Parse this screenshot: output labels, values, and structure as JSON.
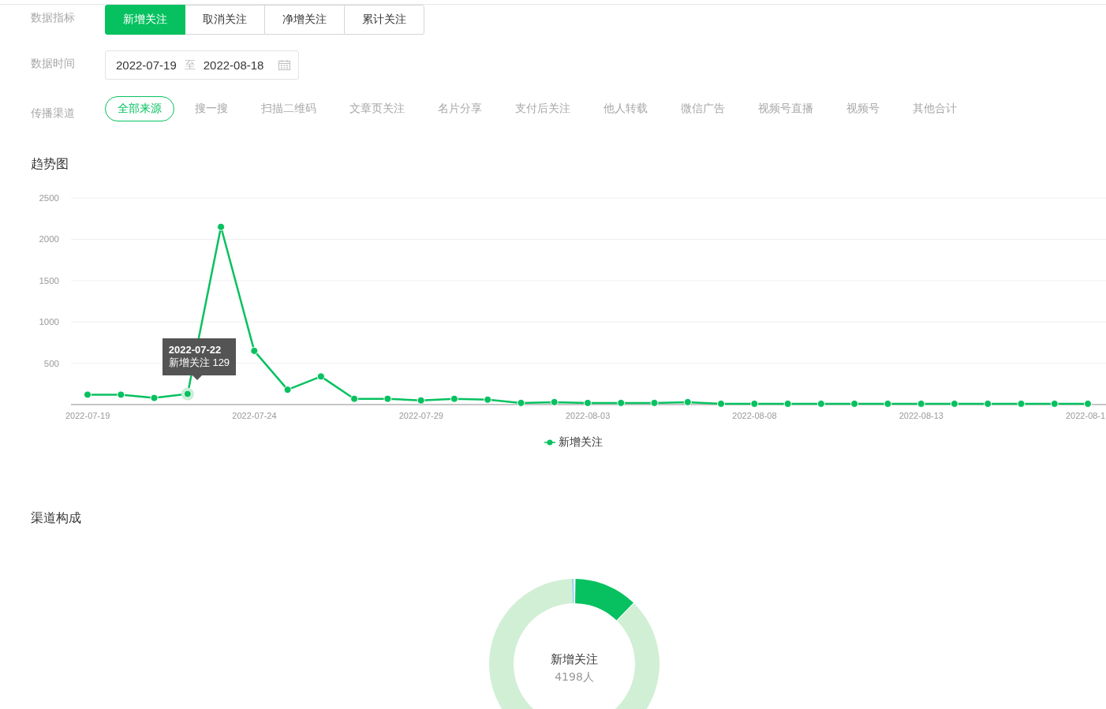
{
  "filters": {
    "metric": {
      "label": "数据指标",
      "options": [
        {
          "label": "新增关注",
          "selected": true
        },
        {
          "label": "取消关注",
          "selected": false
        },
        {
          "label": "净增关注",
          "selected": false
        },
        {
          "label": "累计关注",
          "selected": false
        }
      ]
    },
    "date_range": {
      "label": "数据时间",
      "start": "2022-07-19",
      "separator": "至",
      "end": "2022-08-18"
    },
    "channel": {
      "label": "传播渠道",
      "options": [
        {
          "label": "全部来源",
          "selected": true
        },
        {
          "label": "搜一搜",
          "selected": false
        },
        {
          "label": "扫描二维码",
          "selected": false
        },
        {
          "label": "文章页关注",
          "selected": false
        },
        {
          "label": "名片分享",
          "selected": false
        },
        {
          "label": "支付后关注",
          "selected": false
        },
        {
          "label": "他人转载",
          "selected": false
        },
        {
          "label": "微信广告",
          "selected": false
        },
        {
          "label": "视频号直播",
          "selected": false
        },
        {
          "label": "视频号",
          "selected": false
        },
        {
          "label": "其他合计",
          "selected": false
        }
      ]
    }
  },
  "trend": {
    "title": "趋势图",
    "chart_data": {
      "type": "line",
      "categories": [
        "2022-07-19",
        null,
        null,
        null,
        null,
        "2022-07-24",
        null,
        null,
        null,
        null,
        "2022-07-29",
        null,
        null,
        null,
        null,
        "2022-08-03",
        null,
        null,
        null,
        null,
        "2022-08-08",
        null,
        null,
        null,
        null,
        "2022-08-13",
        null,
        null,
        null,
        null,
        "2022-08-1"
      ],
      "series": [
        {
          "name": "新增关注",
          "color": "#07c160",
          "marker": "circle",
          "values": [
            120,
            120,
            80,
            129,
            2150,
            650,
            180,
            340,
            70,
            70,
            50,
            70,
            60,
            20,
            30,
            20,
            20,
            20,
            30,
            10,
            10,
            10,
            10,
            10,
            10,
            10,
            10,
            10,
            10,
            10,
            10
          ]
        }
      ],
      "ylim": [
        0,
        2500
      ],
      "yticks": [
        500,
        1000,
        1500,
        2000,
        2500
      ],
      "grid": true,
      "annotations": [
        "**2022-07-22**\n新增关注 129"
      ]
    }
  },
  "composition": {
    "title": "渠道构成",
    "center_title": "新增关注",
    "center_value": "4198人"
  }
}
